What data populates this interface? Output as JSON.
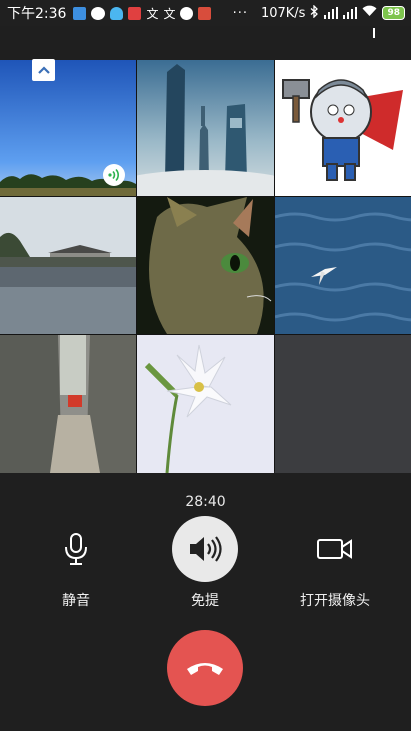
{
  "status_bar": {
    "time": "下午2:36",
    "net_speed": "107K/s",
    "dots": "···",
    "battery": "98",
    "icons": [
      "notes-icon",
      "wechat-icon",
      "qq-icon",
      "app-red-icon",
      "text-app-icon",
      "text-app-icon",
      "check-circle-icon",
      "photo-app-icon",
      "bluetooth-icon",
      "signal-icon",
      "signal-icon",
      "wifi-icon",
      "battery-icon"
    ]
  },
  "call": {
    "duration": "28:40",
    "controls": [
      {
        "label": "静音",
        "icon": "microphone-icon",
        "active": false
      },
      {
        "label": "免提",
        "icon": "speaker-icon",
        "active": true
      },
      {
        "label": "打开摄像头",
        "icon": "camera-icon",
        "active": false
      }
    ],
    "hangup_icon": "hangup-phone-icon"
  },
  "participants": [
    {
      "image": "blue-sky-trees",
      "speaking": true
    },
    {
      "image": "city-skyscrapers"
    },
    {
      "image": "cartoon-hero"
    },
    {
      "image": "river-village"
    },
    {
      "image": "cat-closeup"
    },
    {
      "image": "seagull-sea"
    },
    {
      "image": "narrow-alley"
    },
    {
      "image": "white-lily"
    },
    {
      "image": "empty-slot"
    }
  ],
  "colors": {
    "background": "#1f1f1f",
    "hangup": "#e45451",
    "speaker_active": "#e9e9e9",
    "battery": "#7dc44d",
    "speaking": "#2bb24c"
  }
}
